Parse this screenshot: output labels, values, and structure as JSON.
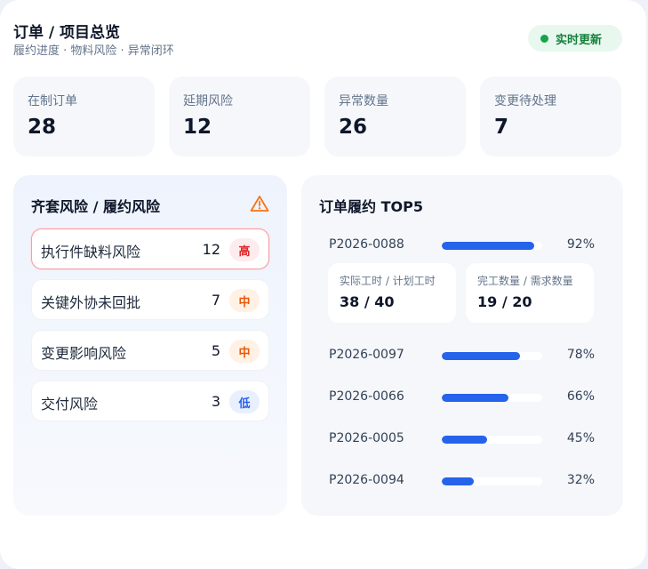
{
  "header": {
    "title": "订单 / 项目总览",
    "subtitle": "履约进度 · 物料风险 · 异常闭环",
    "live_label": "实时更新"
  },
  "stats": [
    {
      "label": "在制订单",
      "value": "28"
    },
    {
      "label": "延期风险",
      "value": "12"
    },
    {
      "label": "异常数量",
      "value": "26"
    },
    {
      "label": "变更待处理",
      "value": "7"
    }
  ],
  "risk_panel": {
    "title": "齐套风险 / 履约风险",
    "items": [
      {
        "label": "执行件缺料风险",
        "count": "12",
        "level": "高"
      },
      {
        "label": "关键外协未回批",
        "count": "7",
        "level": "中"
      },
      {
        "label": "变更影响风险",
        "count": "5",
        "level": "中"
      },
      {
        "label": "交付风险",
        "count": "3",
        "level": "低"
      }
    ]
  },
  "orders_panel": {
    "title": "订单履约 TOP5",
    "orders": [
      {
        "id": "P2026-0088",
        "progress": 92,
        "pct_label": "92%"
      },
      {
        "id": "P2026-0097",
        "progress": 78,
        "pct_label": "78%"
      },
      {
        "id": "P2026-0066",
        "progress": 66,
        "pct_label": "66%"
      },
      {
        "id": "P2026-0005",
        "progress": 45,
        "pct_label": "45%"
      },
      {
        "id": "P2026-0094",
        "progress": 32,
        "pct_label": "32%"
      }
    ],
    "details": [
      {
        "label": "实际工时 / 计划工时",
        "value": "38 / 40"
      },
      {
        "label": "完工数量 / 需求数量",
        "value": "19 / 20"
      }
    ]
  },
  "colors": {
    "accent": "#2563eb",
    "live": "#16a34a",
    "high": "#dc2626",
    "mid": "#ea580c",
    "low": "#2563eb",
    "warning_icon": "#f97316"
  },
  "icons": {
    "live_indicator": "green-dot-icon",
    "risk_panel": "warning-triangle-icon"
  }
}
